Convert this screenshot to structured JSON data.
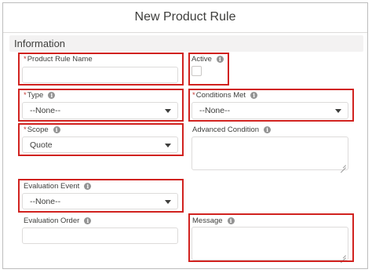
{
  "modal": {
    "title": "New Product Rule"
  },
  "section": {
    "title": "Information"
  },
  "fields": {
    "product_rule_name": {
      "label": "Product Rule Name",
      "required": "*",
      "value": ""
    },
    "active": {
      "label": "Active",
      "checked": false
    },
    "type": {
      "label": "Type",
      "required": "*",
      "value": "--None--"
    },
    "conditions_met": {
      "label": "Conditions Met",
      "required": "*",
      "value": "--None--"
    },
    "scope": {
      "label": "Scope",
      "required": "*",
      "value": "Quote"
    },
    "advanced_condition": {
      "label": "Advanced Condition",
      "value": ""
    },
    "evaluation_event": {
      "label": "Evaluation Event",
      "value": "--None--"
    },
    "evaluation_order": {
      "label": "Evaluation Order",
      "value": ""
    },
    "message": {
      "label": "Message",
      "value": ""
    }
  },
  "icons": {
    "info": "info-icon",
    "dropdown": "chevron-down-icon",
    "resize": "resize-grip-icon"
  },
  "colors": {
    "highlight": "#d1221f",
    "required": "#c23934",
    "section_bg": "#f3f2f2"
  }
}
